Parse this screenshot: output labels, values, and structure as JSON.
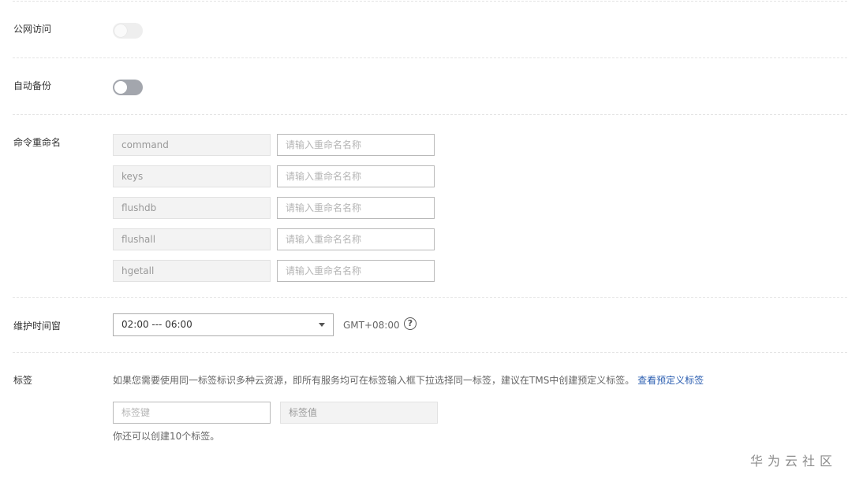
{
  "public_access": {
    "label": "公网访问",
    "enabled": false,
    "disabled": true
  },
  "auto_backup": {
    "label": "自动备份",
    "enabled": false
  },
  "command_rename": {
    "label": "命令重命名",
    "placeholder": "请输入重命名名称",
    "commands": [
      "command",
      "keys",
      "flushdb",
      "flushall",
      "hgetall"
    ]
  },
  "maintenance_window": {
    "label": "维护时间窗",
    "selected": "02:00 --- 06:00",
    "timezone": "GMT+08:00",
    "help_glyph": "?"
  },
  "tags": {
    "label": "标签",
    "description": "如果您需要使用同一标签标识多种云资源，即所有服务均可在标签输入框下拉选择同一标签，建议在TMS中创建预定义标签。",
    "link_text": "查看预定义标签",
    "key_placeholder": "标签键",
    "value_placeholder": "标签值",
    "hint": "你还可以创建10个标签。"
  },
  "watermark": "华为云社区",
  "colors": {
    "link": "#2a5db0",
    "toggle_off": "#a3a6ad",
    "border": "#b9b9b9"
  }
}
